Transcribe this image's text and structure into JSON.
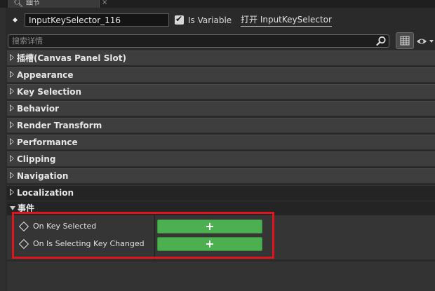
{
  "tab": {
    "label": "细节",
    "icon": "magnifier-icon",
    "close": "×"
  },
  "header": {
    "name_value": "InputKeySelector_116",
    "is_variable_label": "Is Variable",
    "is_variable_checked": true,
    "open_link": "打开 InputKeySelector"
  },
  "search": {
    "placeholder": "搜索详情"
  },
  "categories": [
    {
      "label": "插槽(Canvas Panel Slot)"
    },
    {
      "label": "Appearance"
    },
    {
      "label": "Key Selection"
    },
    {
      "label": "Behavior"
    },
    {
      "label": "Render Transform"
    },
    {
      "label": "Performance"
    },
    {
      "label": "Clipping"
    },
    {
      "label": "Navigation"
    },
    {
      "label": "Localization"
    }
  ],
  "events": {
    "label": "事件",
    "rows": [
      {
        "label": "On Key Selected",
        "button": "+"
      },
      {
        "label": "On Is Selecting Key Changed",
        "button": "+"
      }
    ]
  },
  "colors": {
    "accent_green": "#4caf50",
    "highlight_red": "#e0141c"
  }
}
